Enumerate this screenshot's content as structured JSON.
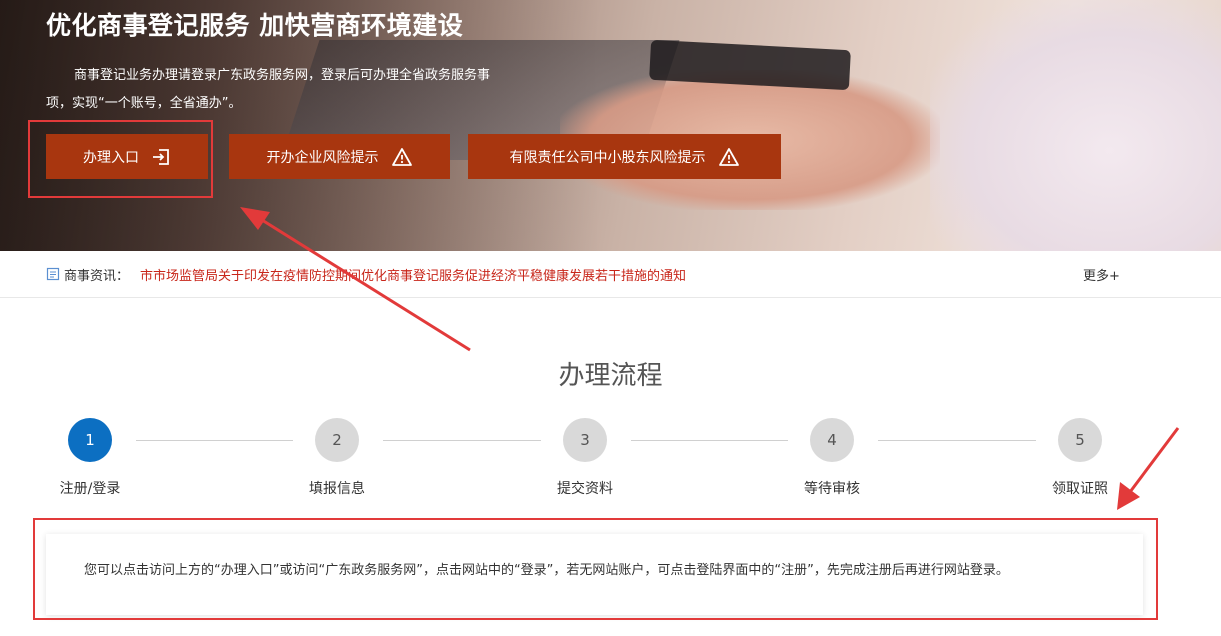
{
  "hero": {
    "title": "优化商事登记服务 加快营商环境建设",
    "description": "商事登记业务办理请登录广东政务服务网，登录后可办理全省政务服务事项，实现“一个账号，全省通办”。",
    "buttons": [
      {
        "label": "办理入口",
        "icon": "sign-in-icon"
      },
      {
        "label": "开办企业风险提示",
        "icon": "warning-icon"
      },
      {
        "label": "有限责任公司中小股东风险提示",
        "icon": "warning-icon"
      }
    ]
  },
  "news": {
    "icon": "news-icon",
    "label": "商事资讯：",
    "item": "市市场监管局关于印发在疫情防控期间优化商事登记服务促进经济平稳健康发展若干措施的通知",
    "more": "更多+"
  },
  "process": {
    "title": "办理流程",
    "steps": [
      {
        "num": "1",
        "label": "注册/登录",
        "active": true
      },
      {
        "num": "2",
        "label": "填报信息",
        "active": false
      },
      {
        "num": "3",
        "label": "提交资料",
        "active": false
      },
      {
        "num": "4",
        "label": "等待审核",
        "active": false
      },
      {
        "num": "5",
        "label": "领取证照",
        "active": false
      }
    ],
    "info": "您可以点击访问上方的“办理入口”或访问“广东政务服务网”，点击网站中的“登录”，若无网站账户，可点击登陆界面中的“注册”，先完成注册后再进行网站登录。"
  },
  "colors": {
    "button": "#a8360f",
    "active_step": "#0c6fc2",
    "annotation": "#e23a3a",
    "news_link": "#c8261a"
  }
}
